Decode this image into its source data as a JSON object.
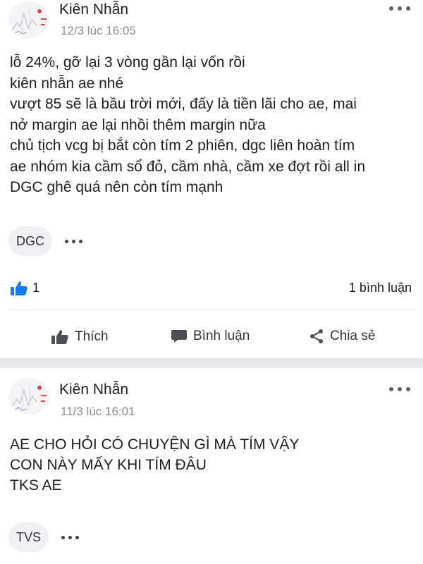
{
  "posts": [
    {
      "author": "Kiên Nhẫn",
      "timestamp": "12/3 lúc 16:05",
      "lines": [
        "lỗ 24%, gỡ lại 3 vòng gần lại vốn rồi",
        "kiên nhẫn ae nhé",
        "vượt 85 sẽ là bầu trời mới, đấy là tiền lãi cho ae, mai",
        "nở margin ae lại nhồi thêm margin nữa",
        "chủ tịch vcg bị bắt còn tím 2 phiên, dgc liên hoàn tím",
        "ae nhóm kia cầm sổ đỏ, cầm nhà, cầm xe đợt rồi all in",
        "DGC ghê quá nên còn tím mạnh"
      ],
      "tag": "DGC",
      "like_count": "1",
      "comment_count": "1 bình luận",
      "actions": {
        "like": "Thích",
        "comment": "Bình luận",
        "share": "Chia sẻ"
      }
    },
    {
      "author": "Kiên Nhẫn",
      "timestamp": "11/3 lúc 16:01",
      "lines": [
        "AE CHO HỎI CÓ CHUYỆN GÌ MÀ TÍM VẬY",
        "CON NÀY MẤY KHI TÍM ĐÂU",
        "TKS AE"
      ],
      "tag": "TVS"
    }
  ],
  "colors": {
    "like_blue": "#1877f2",
    "separator": "#e7e8ec",
    "timestamp": "#8a8d91"
  }
}
